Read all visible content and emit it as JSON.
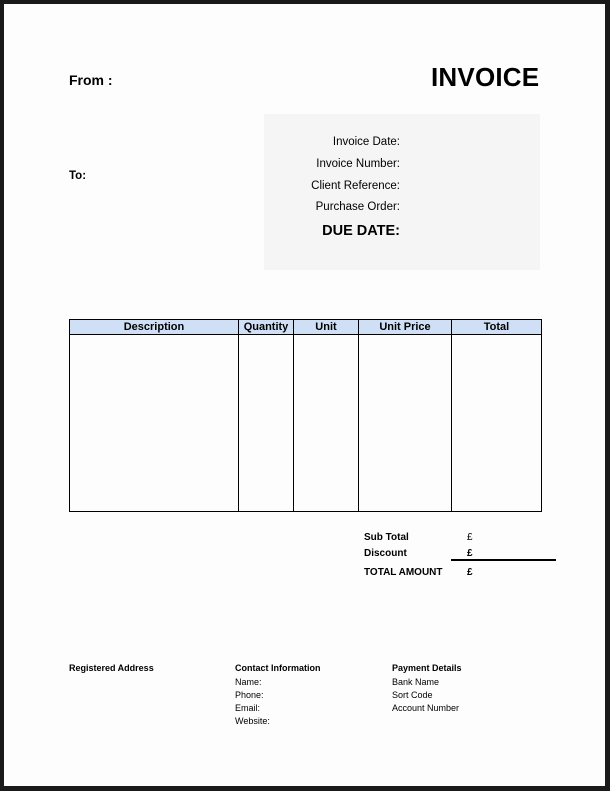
{
  "header": {
    "from_label": "From :",
    "title": "INVOICE",
    "to_label": "To:"
  },
  "meta": {
    "invoice_date_label": "Invoice Date:",
    "invoice_number_label": "Invoice Number:",
    "client_reference_label": "Client Reference:",
    "purchase_order_label": "Purchase Order:",
    "due_date_label": "DUE DATE:"
  },
  "table": {
    "columns": [
      "Description",
      "Quantity",
      "Unit",
      "Unit Price",
      "Total"
    ],
    "header_color": "#cfe0f6",
    "rows": []
  },
  "totals": {
    "sub_total_label": "Sub Total",
    "sub_total_currency": "£",
    "discount_label": "Discount",
    "discount_currency": "£",
    "total_amount_label": "TOTAL AMOUNT",
    "total_amount_currency": "£"
  },
  "footer": {
    "registered_address_label": "Registered Address",
    "contact": {
      "heading": "Contact Information",
      "items": [
        "Name:",
        "Phone:",
        "Email:",
        "Website:"
      ]
    },
    "payment": {
      "heading": "Payment Details",
      "items": [
        "Bank Name",
        "Sort Code",
        "Account Number"
      ]
    }
  }
}
